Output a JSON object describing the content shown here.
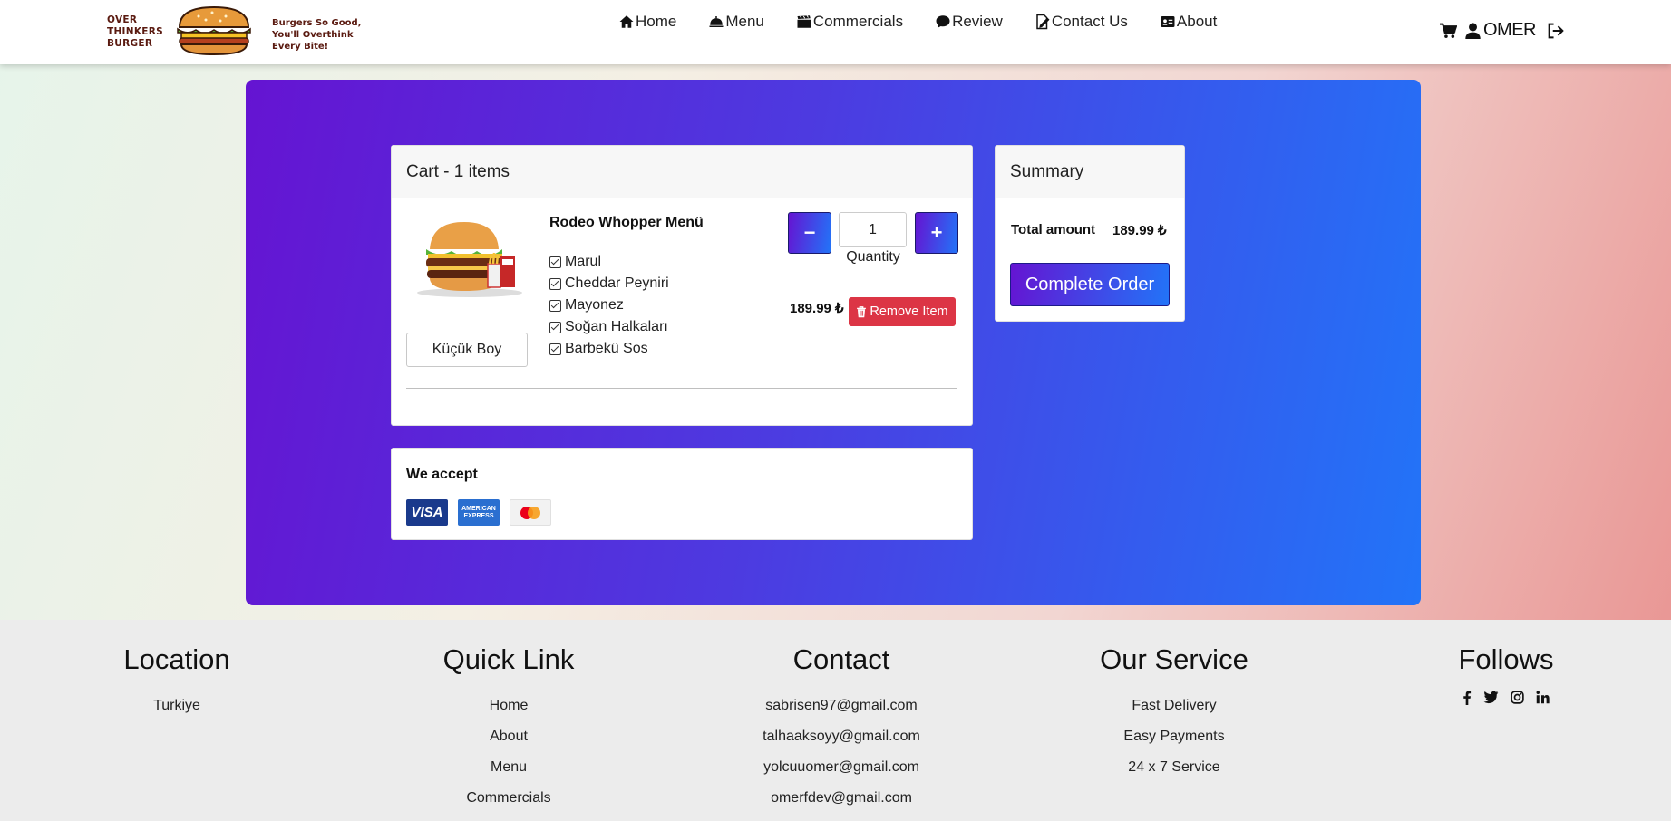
{
  "brand": {
    "name_lines": [
      "OVER",
      "THINKERS",
      "BURGER"
    ],
    "tagline_lines": [
      "Burgers So Good,",
      "You'll Overthink",
      "Every Bite!"
    ]
  },
  "nav": {
    "items": [
      {
        "label": "Home",
        "icon": "home-icon"
      },
      {
        "label": "Menu",
        "icon": "cloche-icon"
      },
      {
        "label": "Commercials",
        "icon": "clapperboard-icon"
      },
      {
        "label": "Review",
        "icon": "comment-icon"
      },
      {
        "label": "Contact Us",
        "icon": "file-signature-icon"
      },
      {
        "label": "About",
        "icon": "id-card-icon"
      }
    ],
    "user_name": "OMER",
    "icons": [
      "cart-icon",
      "user-icon",
      "logout-icon"
    ]
  },
  "cart": {
    "header": "Cart - 1 items",
    "item": {
      "name": "Rodeo Whopper Menü",
      "size": "Küçük Boy",
      "options": [
        "Marul",
        "Cheddar Peyniri",
        "Mayonez",
        "Soğan Halkaları",
        "Barbekü Sos"
      ],
      "quantity": "1",
      "quantity_label": "Quantity",
      "minus_label": "−",
      "plus_label": "+",
      "price": "189.99 ₺",
      "remove_label": "Remove Item"
    }
  },
  "summary": {
    "header": "Summary",
    "total_label": "Total amount",
    "total_value": "189.99 ₺",
    "complete_label": "Complete Order"
  },
  "accept": {
    "title": "We accept",
    "visa": "VISA",
    "amex_lines": [
      "AMERICAN",
      "EXPRESS"
    ]
  },
  "footer": {
    "location": {
      "title": "Location",
      "items": [
        "Turkiye"
      ]
    },
    "quick_link": {
      "title": "Quick Link",
      "items": [
        "Home",
        "About",
        "Menu",
        "Commercials"
      ]
    },
    "contact": {
      "title": "Contact",
      "items": [
        "sabrisen97@gmail.com",
        "talhaaksoyy@gmail.com",
        "yolcuuomer@gmail.com",
        "omerfdev@gmail.com"
      ]
    },
    "service": {
      "title": "Our Service",
      "items": [
        "Fast Delivery",
        "Easy Payments",
        "24 x 7 Service"
      ]
    },
    "follows": {
      "title": "Follows",
      "icons": [
        "facebook-icon",
        "twitter-icon",
        "instagram-icon",
        "linkedin-icon"
      ]
    }
  },
  "colors": {
    "gradient_start": "#6514d2",
    "gradient_end": "#2274f8",
    "remove": "#dc3545",
    "footer_bg": "#ececec"
  }
}
